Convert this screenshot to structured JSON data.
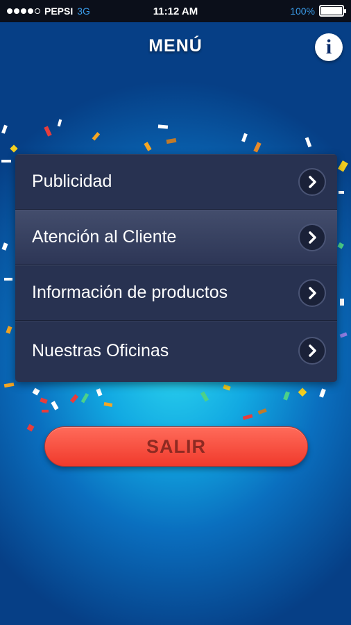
{
  "status_bar": {
    "carrier": "PEPSI",
    "network": "3G",
    "time": "11:12 AM",
    "battery": "100%"
  },
  "header": {
    "title": "MENÚ",
    "info_label": "i"
  },
  "menu": {
    "items": [
      {
        "label": "Publicidad"
      },
      {
        "label": "Atención al Cliente"
      },
      {
        "label": "Información de productos"
      },
      {
        "label": "Nuestras Oficinas"
      }
    ]
  },
  "exit_button": {
    "label": "SALIR"
  },
  "colors": {
    "accent": "#f03a2c",
    "menu_bg": "#283251",
    "background": "#12a9e2"
  }
}
